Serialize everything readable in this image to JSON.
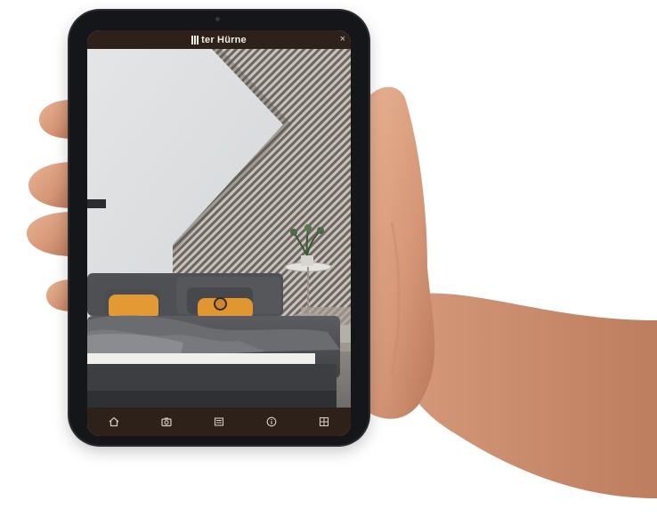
{
  "app": {
    "brand_name": "ter Hürne"
  },
  "header": {
    "close_glyph": "×"
  },
  "bottom_nav": {
    "items": [
      {
        "icon": "home-icon"
      },
      {
        "icon": "camera-icon"
      },
      {
        "icon": "menu-icon"
      },
      {
        "icon": "info-icon"
      },
      {
        "icon": "grid-icon"
      }
    ]
  },
  "colors": {
    "app_bar": "#2d2119",
    "device_frame": "#14161a",
    "pillow_accent": "#e39a34"
  }
}
